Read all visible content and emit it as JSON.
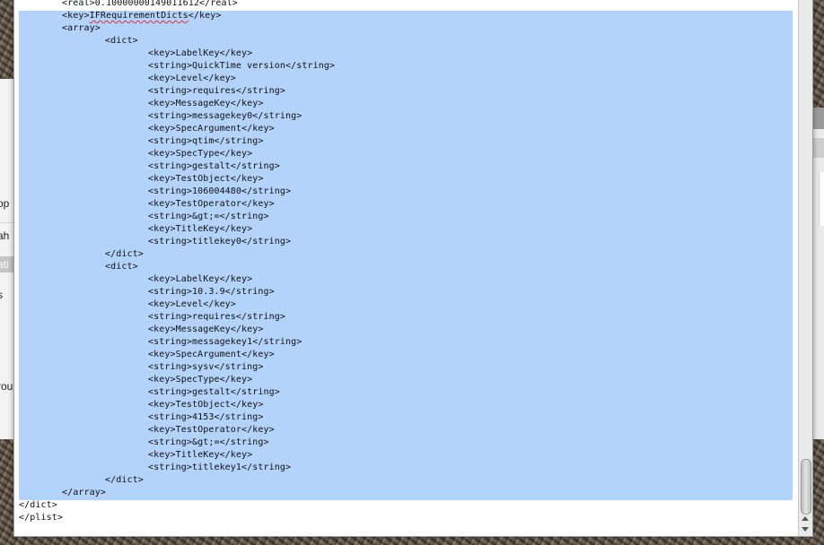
{
  "background_window": {
    "rows": [
      "op",
      "ah",
      "ati",
      "s",
      "rou"
    ]
  },
  "editor": {
    "lines": [
      {
        "indent": 1,
        "text": "<real>0.10000000149011612</real>"
      },
      {
        "indent": 1,
        "pre": "<key>",
        "mark": "IFRequirementDicts",
        "post": "</key>"
      },
      {
        "indent": 1,
        "text": "<array>"
      },
      {
        "indent": 2,
        "text": "<dict>"
      },
      {
        "indent": 3,
        "text": "<key>LabelKey</key>"
      },
      {
        "indent": 3,
        "text": "<string>QuickTime version</string>"
      },
      {
        "indent": 3,
        "text": "<key>Level</key>"
      },
      {
        "indent": 3,
        "text": "<string>requires</string>"
      },
      {
        "indent": 3,
        "text": "<key>MessageKey</key>"
      },
      {
        "indent": 3,
        "text": "<string>messagekey0</string>"
      },
      {
        "indent": 3,
        "text": "<key>SpecArgument</key>"
      },
      {
        "indent": 3,
        "text": "<string>qtim</string>"
      },
      {
        "indent": 3,
        "text": "<key>SpecType</key>"
      },
      {
        "indent": 3,
        "text": "<string>gestalt</string>"
      },
      {
        "indent": 3,
        "text": "<key>TestObject</key>"
      },
      {
        "indent": 3,
        "text": "<string>106004480</string>"
      },
      {
        "indent": 3,
        "text": "<key>TestOperator</key>"
      },
      {
        "indent": 3,
        "text": "<string>&gt;=</string>"
      },
      {
        "indent": 3,
        "text": "<key>TitleKey</key>"
      },
      {
        "indent": 3,
        "text": "<string>titlekey0</string>"
      },
      {
        "indent": 2,
        "text": "</dict>"
      },
      {
        "indent": 2,
        "text": "<dict>"
      },
      {
        "indent": 3,
        "text": "<key>LabelKey</key>"
      },
      {
        "indent": 3,
        "text": "<string>10.3.9</string>"
      },
      {
        "indent": 3,
        "text": "<key>Level</key>"
      },
      {
        "indent": 3,
        "text": "<string>requires</string>"
      },
      {
        "indent": 3,
        "text": "<key>MessageKey</key>"
      },
      {
        "indent": 3,
        "text": "<string>messagekey1</string>"
      },
      {
        "indent": 3,
        "text": "<key>SpecArgument</key>"
      },
      {
        "indent": 3,
        "text": "<string>sysv</string>"
      },
      {
        "indent": 3,
        "text": "<key>SpecType</key>"
      },
      {
        "indent": 3,
        "text": "<string>gestalt</string>"
      },
      {
        "indent": 3,
        "text": "<key>TestObject</key>"
      },
      {
        "indent": 3,
        "text": "<string>4153</string>"
      },
      {
        "indent": 3,
        "text": "<key>TestOperator</key>"
      },
      {
        "indent": 3,
        "text": "<string>&gt;=</string>"
      },
      {
        "indent": 3,
        "text": "<key>TitleKey</key>"
      },
      {
        "indent": 3,
        "text": "<string>titlekey1</string>"
      },
      {
        "indent": 2,
        "text": "</dict>"
      },
      {
        "indent": 1,
        "text": "</array>"
      },
      {
        "indent": 0,
        "text": "</dict>"
      },
      {
        "indent": 0,
        "text": "</plist>"
      }
    ]
  },
  "colors": {
    "selection": "#b3d3fa",
    "spellcheck_underline": "#e0303a"
  }
}
